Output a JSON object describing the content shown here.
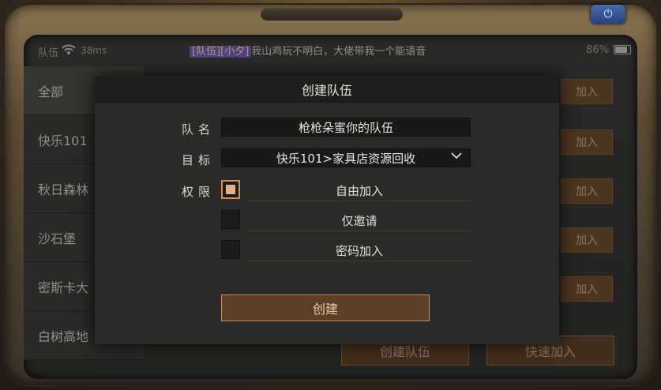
{
  "status": {
    "team": "队伍",
    "wifi_icon": "wifi-icon",
    "ping": "38ms",
    "chat_tag": "[队伍][小夕]",
    "chat_message": "我山鸡玩不明白，大佬带我一个能语音",
    "battery": "86%"
  },
  "sidebar": {
    "items": [
      {
        "label": "全部"
      },
      {
        "label": "快乐101"
      },
      {
        "label": "秋日森林"
      },
      {
        "label": "沙石堡"
      },
      {
        "label": "密斯卡大"
      },
      {
        "label": "白树高地"
      }
    ]
  },
  "background": {
    "join_label": "加入",
    "create_team_label": "创建队伍",
    "quick_join_label": "快速加入"
  },
  "modal": {
    "title": "创建队伍",
    "name_label": "队名",
    "name_value": "枪枪朵蜜你的队伍",
    "target_label": "目标",
    "target_value": "快乐101>家具店资源回收",
    "permission_label": "权限",
    "permissions": [
      {
        "label": "自由加入",
        "checked": true
      },
      {
        "label": "仅邀请",
        "checked": false
      },
      {
        "label": "密码加入",
        "checked": false
      }
    ],
    "create_label": "创建"
  },
  "colors": {
    "accent": "#c98f5a",
    "modal_bg": "#2b2a28",
    "checkbox_fill": "#e2b184"
  }
}
